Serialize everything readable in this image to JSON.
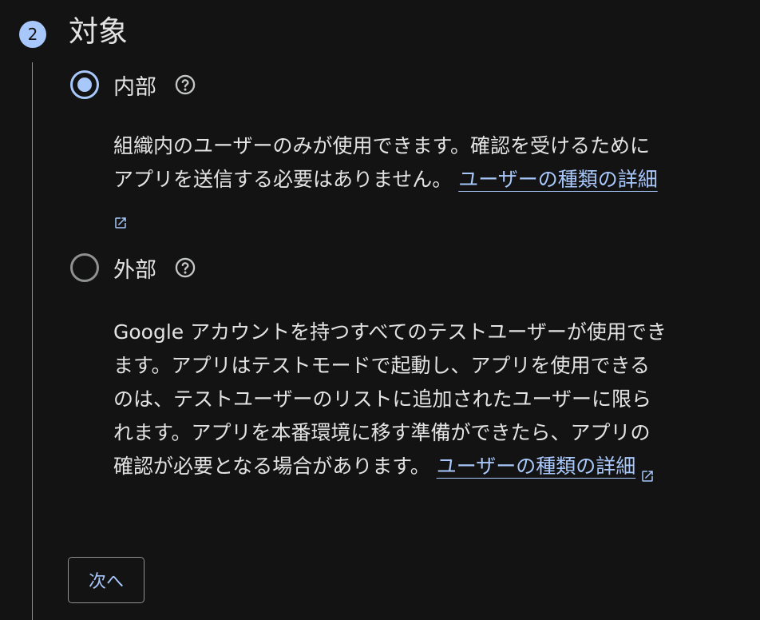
{
  "step": {
    "number": "2",
    "title": "対象"
  },
  "options": {
    "internal": {
      "label": "内部",
      "selected": true,
      "description_lines": [
        "組織内のユーザーのみが使用できます。確認を受けるために",
        "アプリを送信する必要はありません。"
      ],
      "link_text": "ユーザーの種類の詳細"
    },
    "external": {
      "label": "外部",
      "selected": false,
      "description_lines": [
        "Google アカウントを持つすべてのテストユーザーが使用でき",
        "ます。アプリはテストモードで起動し、アプリを使用できる",
        "のは、テストユーザーのリストに追加されたユーザーに限ら",
        "れます。アプリを本番環境に移す準備ができたら、アプリの",
        "確認が必要となる場合があります。"
      ],
      "link_text": "ユーザーの種類の詳細"
    }
  },
  "actions": {
    "next_label": "次へ"
  },
  "icons": {
    "help": "help-circle-icon",
    "external_link": "open-in-new-icon"
  },
  "colors": {
    "background": "#131314",
    "text": "#e3e3e3",
    "accent": "#a8c7fa",
    "outline": "#8e918f"
  }
}
